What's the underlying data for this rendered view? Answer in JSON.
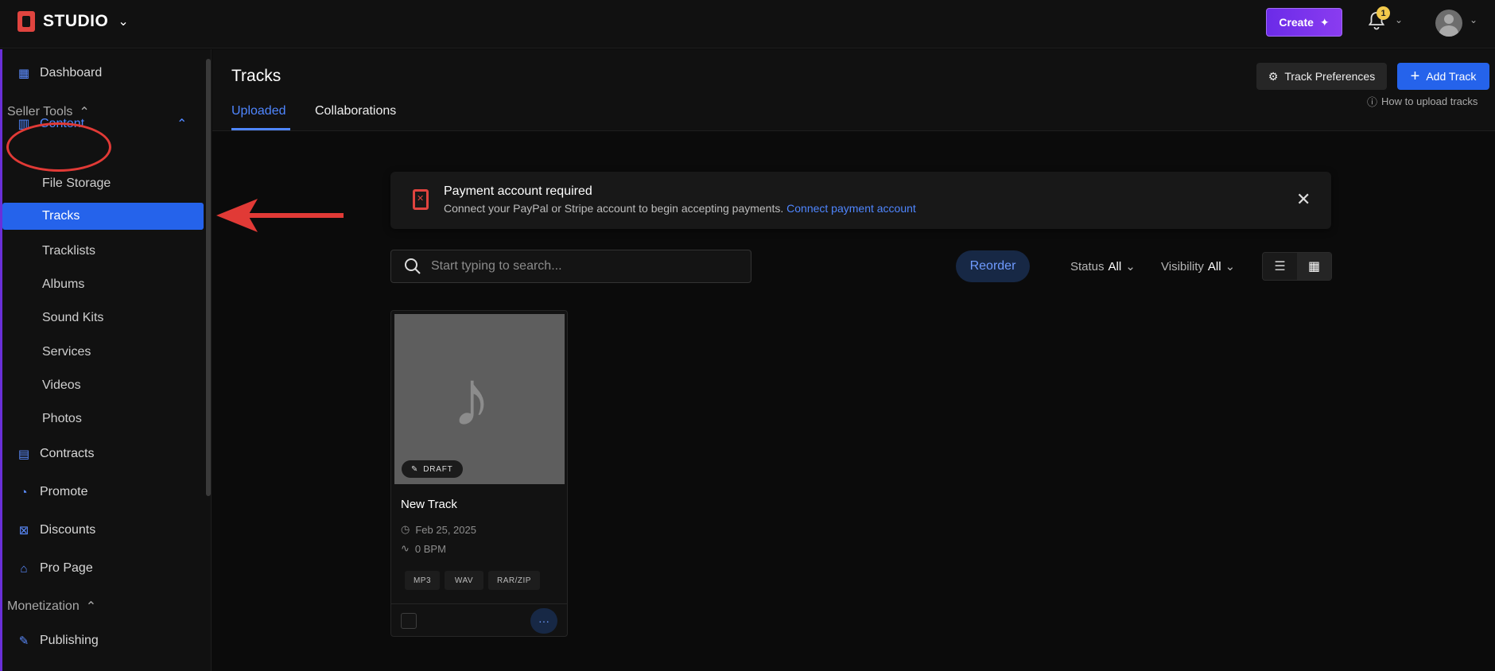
{
  "topbar": {
    "brand": "STUDIO",
    "create_label": "Create",
    "notification_count": "1"
  },
  "sidebar": {
    "dashboard": "Dashboard",
    "seller_tools": "Seller Tools",
    "content": "Content",
    "sub_items": [
      "File Storage",
      "Tracks",
      "Tracklists",
      "Albums",
      "Sound Kits",
      "Services",
      "Videos",
      "Photos"
    ],
    "active_item": "Tracks",
    "contracts": "Contracts",
    "promote": "Promote",
    "discounts": "Discounts",
    "pro_page": "Pro Page",
    "monetization": "Monetization",
    "publishing": "Publishing"
  },
  "header": {
    "title": "Tracks",
    "tabs": [
      {
        "label": "Uploaded",
        "active": true
      },
      {
        "label": "Collaborations",
        "active": false
      }
    ],
    "preferences_label": "Track Preferences",
    "add_track_label": "Add Track",
    "how_to_label": "How to upload tracks"
  },
  "banner": {
    "title": "Payment account required",
    "text": "Connect your PayPal or Stripe account to begin accepting payments.",
    "link": "Connect payment account"
  },
  "toolbar": {
    "search_placeholder": "Start typing to search...",
    "reorder_label": "Reorder",
    "status_label": "Status",
    "status_value": "All",
    "visibility_label": "Visibility",
    "visibility_value": "All"
  },
  "tracks": [
    {
      "status": "DRAFT",
      "title": "New Track",
      "date": "Feb 25, 2025",
      "bpm": "0 BPM",
      "formats": [
        "MP3",
        "WAV",
        "RAR/ZIP"
      ],
      "more": "···"
    }
  ],
  "colors": {
    "accent": "#2563eb",
    "link": "#4f86ff",
    "brand_red": "#e0443f",
    "create_purple": "#7b34ee",
    "annotation_red": "#e13a36"
  }
}
